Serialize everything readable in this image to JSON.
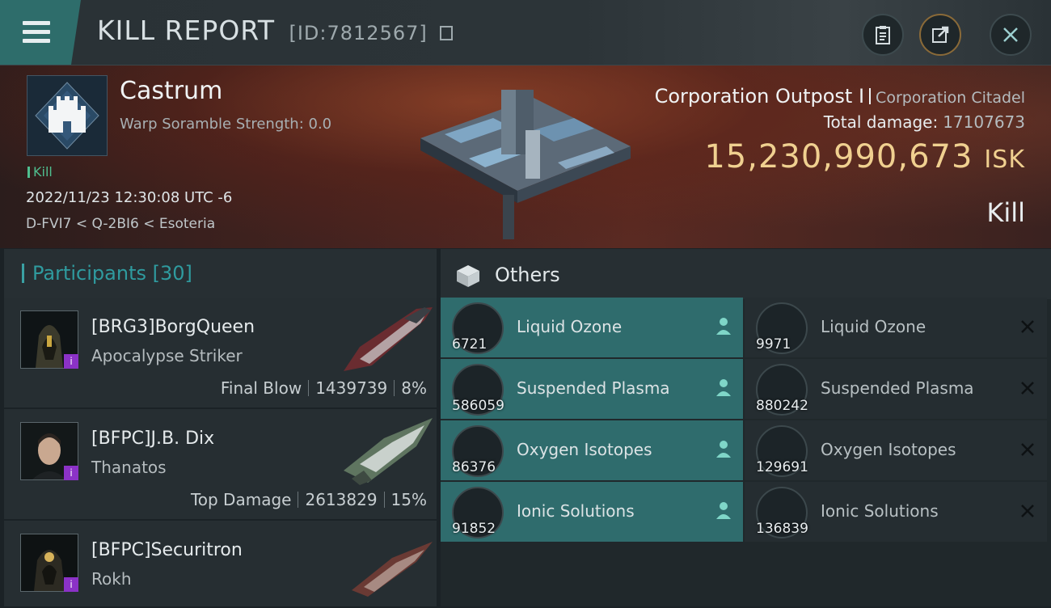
{
  "header": {
    "title": "KILL REPORT",
    "report_id": "[ID:7812567]"
  },
  "victim": {
    "structure_name": "Castrum",
    "warp_scramble": "Warp Soramble Strength: 0.0",
    "tag": "Kill",
    "datetime": "2022/11/23 12:30:08 UTC -6",
    "location": "D-FVI7 < Q-2BI6 < Esoteria",
    "structure_type": "Corporation Outpost I",
    "structure_class": "Corporation Citadel",
    "total_damage_label": "Total damage:",
    "total_damage": "17107673",
    "isk_value": "15,230,990,673",
    "isk_unit": "ISK",
    "outcome": "Kill"
  },
  "participants": {
    "label": "Participants",
    "count": "[30]",
    "rows": [
      {
        "name": "[BRG3]BorgQueen",
        "ship": "Apocalypse Striker",
        "role": "Final Blow",
        "damage": "1439739",
        "percent": "8%"
      },
      {
        "name": "[BFPC]J.B. Dix",
        "ship": "Thanatos",
        "role": "Top Damage",
        "damage": "2613829",
        "percent": "15%"
      },
      {
        "name": "[BFPC]Securitron",
        "ship": "Rokh",
        "role": "",
        "damage": "",
        "percent": ""
      }
    ]
  },
  "others": {
    "label": "Others",
    "items": [
      {
        "name": "Liquid Ozone",
        "qty": "6721",
        "state": "teal"
      },
      {
        "name": "Liquid Ozone",
        "qty": "9971",
        "state": "dark"
      },
      {
        "name": "Suspended Plasma",
        "qty": "586059",
        "state": "teal"
      },
      {
        "name": "Suspended Plasma",
        "qty": "880242",
        "state": "dark"
      },
      {
        "name": "Oxygen Isotopes",
        "qty": "86376",
        "state": "teal"
      },
      {
        "name": "Oxygen Isotopes",
        "qty": "129691",
        "state": "dark"
      },
      {
        "name": "Ionic Solutions",
        "qty": "91852",
        "state": "teal"
      },
      {
        "name": "Ionic Solutions",
        "qty": "136839",
        "state": "dark"
      }
    ]
  },
  "colors": {
    "accent_teal": "#2f6c6d",
    "isk_gold": "#f0d090",
    "rarity_purple": "#8b32c7"
  }
}
